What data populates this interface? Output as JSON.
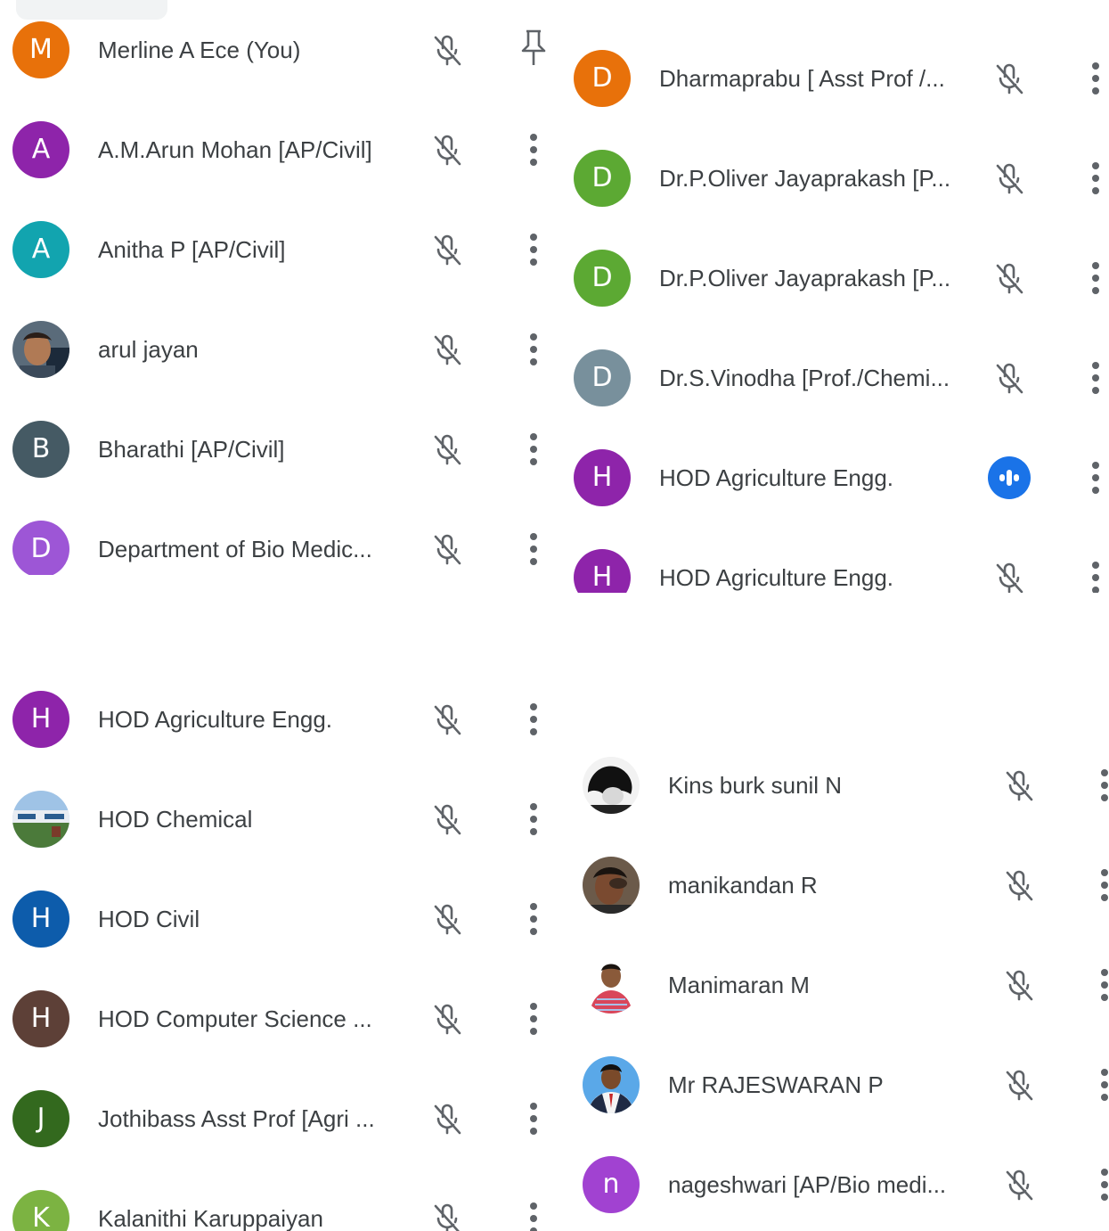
{
  "colors": {
    "orange": "#e8710a",
    "purple": "#8e24aa",
    "teal": "#12a4af",
    "slate": "#455a64",
    "lavender": "#9d56d6",
    "green": "#5ca933",
    "blue_grey": "#78909c",
    "blue": "#0d5cab",
    "brown": "#5d4037",
    "dark_green": "#33691e",
    "light_green": "#7cb342",
    "magenta": "#a142d1",
    "speaking": "#1a73e8"
  },
  "panels": {
    "top_left": [
      {
        "initial": "M",
        "name": "Merline A Ece (You)",
        "color": "#e8710a",
        "mic_icon": "mic-off-icon",
        "action_icon": "pin-icon"
      },
      {
        "initial": "A",
        "name": "A.M.Arun Mohan [AP/Civil]",
        "color": "#8e24aa",
        "mic_icon": "mic-off-icon",
        "action_icon": "more-vert-icon"
      },
      {
        "initial": "A",
        "name": "Anitha P [AP/Civil]",
        "color": "#12a4af",
        "mic_icon": "mic-off-icon",
        "action_icon": "more-vert-icon"
      },
      {
        "initial": "",
        "name": "arul jayan",
        "photo": true,
        "mic_icon": "mic-off-icon",
        "action_icon": "more-vert-icon"
      },
      {
        "initial": "B",
        "name": "Bharathi [AP/Civil]",
        "color": "#455a64",
        "mic_icon": "mic-off-icon",
        "action_icon": "more-vert-icon"
      },
      {
        "initial": "D",
        "name": "Department of Bio Medic...",
        "color": "#9d56d6",
        "mic_icon": "mic-off-icon",
        "action_icon": "more-vert-icon"
      }
    ],
    "top_right": [
      {
        "initial": "D",
        "name": "Dharmaprabu [ Asst Prof /...",
        "color": "#e8710a",
        "mic_icon": "mic-off-icon"
      },
      {
        "initial": "D",
        "name": "Dr.P.Oliver Jayaprakash [P...",
        "color": "#5ca933",
        "mic_icon": "mic-off-icon"
      },
      {
        "initial": "D",
        "name": "Dr.P.Oliver Jayaprakash [P...",
        "color": "#5ca933",
        "mic_icon": "mic-off-icon"
      },
      {
        "initial": "D",
        "name": "Dr.S.Vinodha [Prof./Chemi...",
        "color": "#78909c",
        "mic_icon": "mic-off-icon"
      },
      {
        "initial": "H",
        "name": "HOD Agriculture Engg.",
        "color": "#8e24aa",
        "mic_icon": "speaking-indicator-icon"
      },
      {
        "initial": "H",
        "name": "HOD Agriculture Engg.",
        "color": "#8e24aa",
        "mic_icon": "mic-off-icon"
      }
    ],
    "bottom_left": [
      {
        "initial": "H",
        "name": "HOD Agriculture Engg.",
        "color": "#8e24aa"
      },
      {
        "initial": "",
        "name": "HOD Chemical",
        "photo": true
      },
      {
        "initial": "H",
        "name": "HOD Civil",
        "color": "#0d5cab"
      },
      {
        "initial": "H",
        "name": "HOD Computer Science ...",
        "color": "#5d4037"
      },
      {
        "initial": "J",
        "name": "Jothibass Asst Prof [Agri ...",
        "color": "#33691e"
      },
      {
        "initial": "K",
        "name": "Kalanithi Karuppaiyan",
        "color": "#7cb342"
      }
    ],
    "bottom_right": [
      {
        "initial": "",
        "name": "Kins burk sunil N",
        "photo": true
      },
      {
        "initial": "",
        "name": "manikandan R",
        "photo": true
      },
      {
        "initial": "",
        "name": "Manimaran M",
        "photo": true
      },
      {
        "initial": "",
        "name": "Mr RAJESWARAN P",
        "photo": true
      },
      {
        "initial": "n",
        "name": "nageshwari [AP/Bio medi...",
        "color": "#a142d1"
      }
    ]
  }
}
